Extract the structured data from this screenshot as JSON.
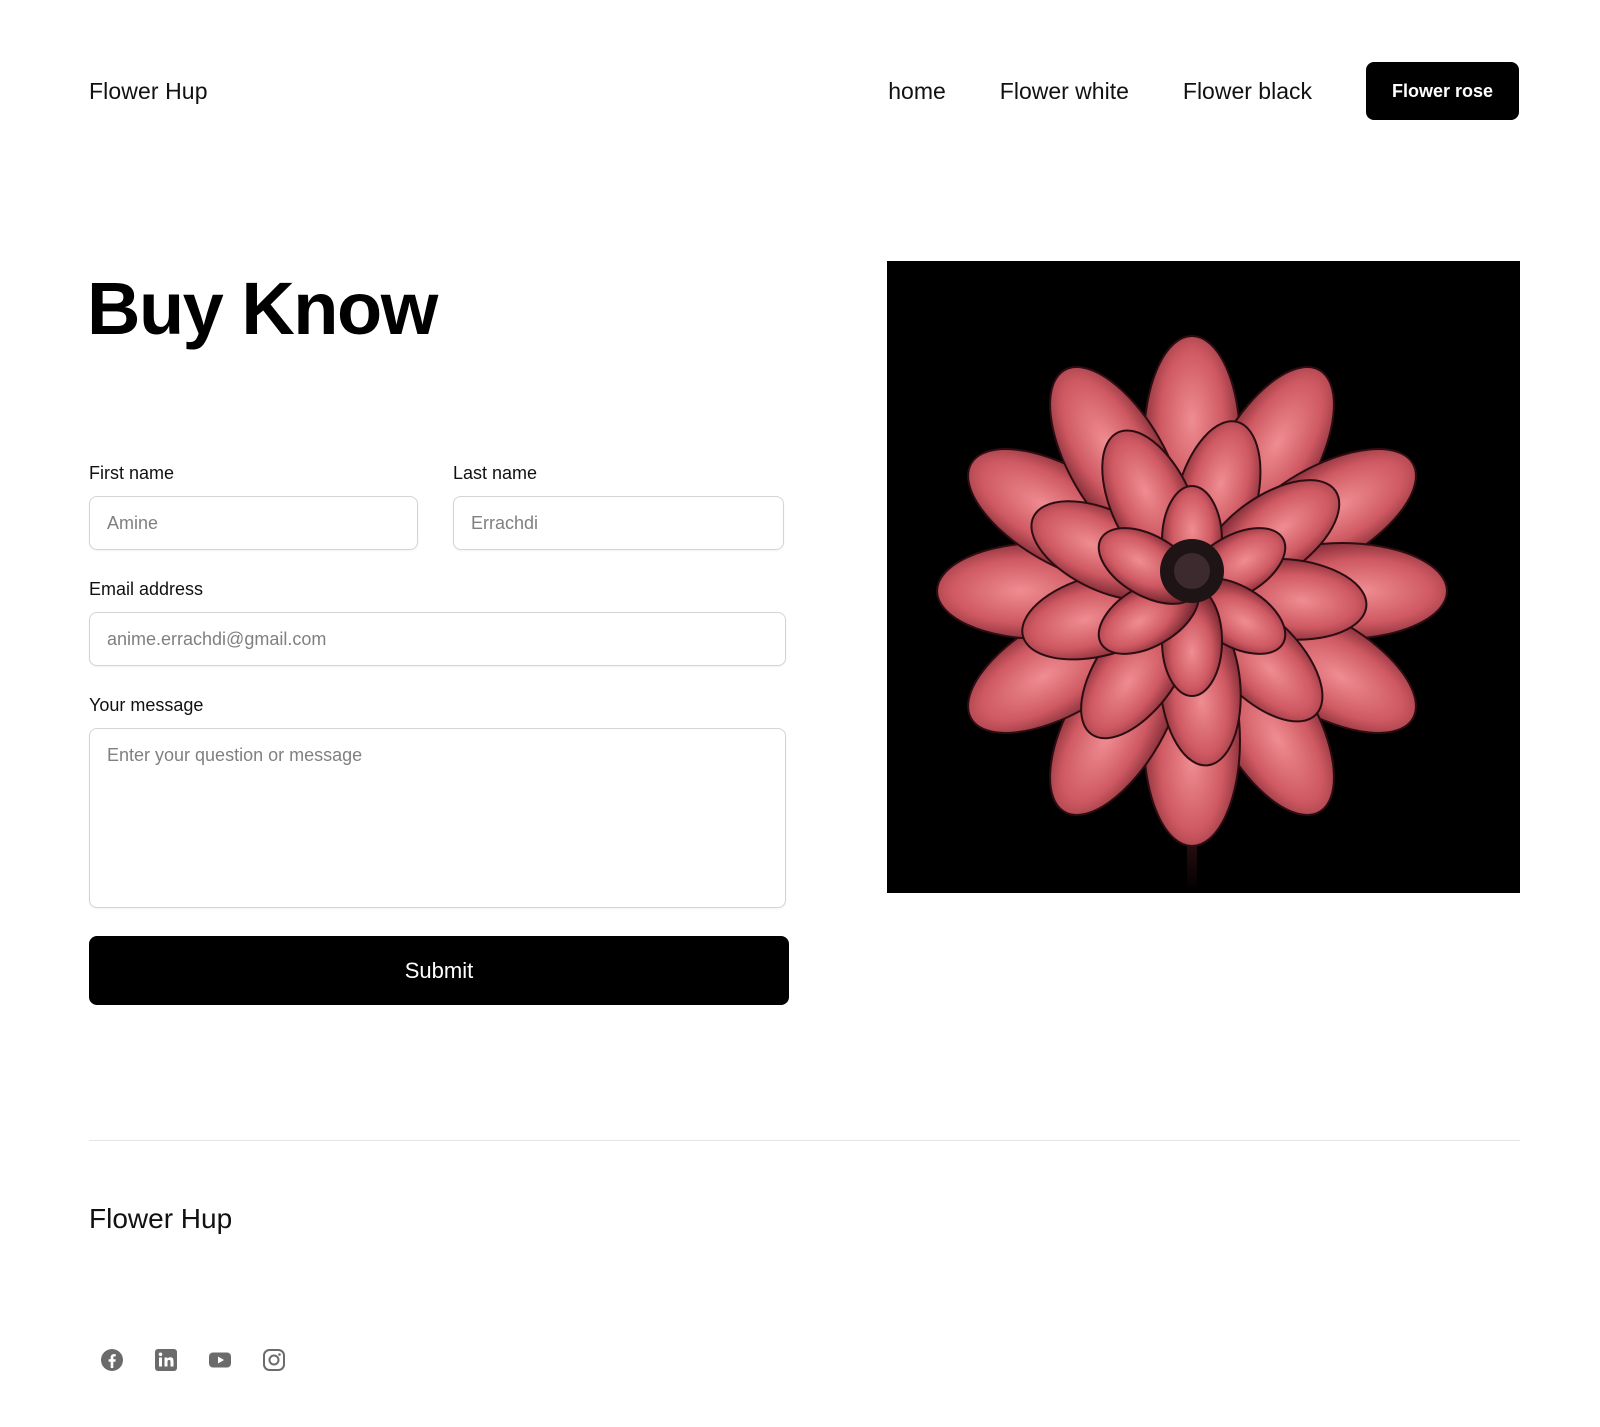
{
  "header": {
    "brand": "Flower Hup",
    "nav": [
      {
        "label": "home"
      },
      {
        "label": "Flower white"
      },
      {
        "label": "Flower black"
      }
    ],
    "cta_label": "Flower rose"
  },
  "main": {
    "title": "Buy Know",
    "form": {
      "first_name": {
        "label": "First name",
        "placeholder": "Amine"
      },
      "last_name": {
        "label": "Last name",
        "placeholder": "Errachdi"
      },
      "email": {
        "label": "Email address",
        "placeholder": "anime.errachdi@gmail.com"
      },
      "message": {
        "label": "Your message",
        "placeholder": "Enter your question or message"
      },
      "submit_label": "Submit"
    },
    "image": {
      "alt": "pink-flower-image"
    }
  },
  "footer": {
    "brand": "Flower Hup",
    "socials": [
      "facebook-icon",
      "linkedin-icon",
      "youtube-icon",
      "instagram-icon"
    ]
  },
  "colors": {
    "primary": "#000000",
    "background": "#ffffff",
    "border": "#d4d4d4",
    "placeholder": "#808080",
    "icon": "#6b6b6b",
    "flower": "#d9626a"
  }
}
